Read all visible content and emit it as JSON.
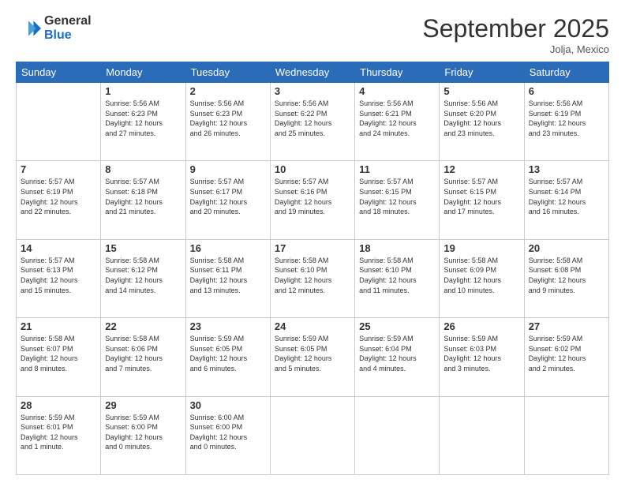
{
  "logo": {
    "general": "General",
    "blue": "Blue"
  },
  "header": {
    "month": "September 2025",
    "location": "Jolja, Mexico"
  },
  "days": [
    "Sunday",
    "Monday",
    "Tuesday",
    "Wednesday",
    "Thursday",
    "Friday",
    "Saturday"
  ],
  "weeks": [
    [
      {
        "num": "",
        "text": ""
      },
      {
        "num": "1",
        "text": "Sunrise: 5:56 AM\nSunset: 6:23 PM\nDaylight: 12 hours\nand 27 minutes."
      },
      {
        "num": "2",
        "text": "Sunrise: 5:56 AM\nSunset: 6:23 PM\nDaylight: 12 hours\nand 26 minutes."
      },
      {
        "num": "3",
        "text": "Sunrise: 5:56 AM\nSunset: 6:22 PM\nDaylight: 12 hours\nand 25 minutes."
      },
      {
        "num": "4",
        "text": "Sunrise: 5:56 AM\nSunset: 6:21 PM\nDaylight: 12 hours\nand 24 minutes."
      },
      {
        "num": "5",
        "text": "Sunrise: 5:56 AM\nSunset: 6:20 PM\nDaylight: 12 hours\nand 23 minutes."
      },
      {
        "num": "6",
        "text": "Sunrise: 5:56 AM\nSunset: 6:19 PM\nDaylight: 12 hours\nand 23 minutes."
      }
    ],
    [
      {
        "num": "7",
        "text": "Sunrise: 5:57 AM\nSunset: 6:19 PM\nDaylight: 12 hours\nand 22 minutes."
      },
      {
        "num": "8",
        "text": "Sunrise: 5:57 AM\nSunset: 6:18 PM\nDaylight: 12 hours\nand 21 minutes."
      },
      {
        "num": "9",
        "text": "Sunrise: 5:57 AM\nSunset: 6:17 PM\nDaylight: 12 hours\nand 20 minutes."
      },
      {
        "num": "10",
        "text": "Sunrise: 5:57 AM\nSunset: 6:16 PM\nDaylight: 12 hours\nand 19 minutes."
      },
      {
        "num": "11",
        "text": "Sunrise: 5:57 AM\nSunset: 6:15 PM\nDaylight: 12 hours\nand 18 minutes."
      },
      {
        "num": "12",
        "text": "Sunrise: 5:57 AM\nSunset: 6:15 PM\nDaylight: 12 hours\nand 17 minutes."
      },
      {
        "num": "13",
        "text": "Sunrise: 5:57 AM\nSunset: 6:14 PM\nDaylight: 12 hours\nand 16 minutes."
      }
    ],
    [
      {
        "num": "14",
        "text": "Sunrise: 5:57 AM\nSunset: 6:13 PM\nDaylight: 12 hours\nand 15 minutes."
      },
      {
        "num": "15",
        "text": "Sunrise: 5:58 AM\nSunset: 6:12 PM\nDaylight: 12 hours\nand 14 minutes."
      },
      {
        "num": "16",
        "text": "Sunrise: 5:58 AM\nSunset: 6:11 PM\nDaylight: 12 hours\nand 13 minutes."
      },
      {
        "num": "17",
        "text": "Sunrise: 5:58 AM\nSunset: 6:10 PM\nDaylight: 12 hours\nand 12 minutes."
      },
      {
        "num": "18",
        "text": "Sunrise: 5:58 AM\nSunset: 6:10 PM\nDaylight: 12 hours\nand 11 minutes."
      },
      {
        "num": "19",
        "text": "Sunrise: 5:58 AM\nSunset: 6:09 PM\nDaylight: 12 hours\nand 10 minutes."
      },
      {
        "num": "20",
        "text": "Sunrise: 5:58 AM\nSunset: 6:08 PM\nDaylight: 12 hours\nand 9 minutes."
      }
    ],
    [
      {
        "num": "21",
        "text": "Sunrise: 5:58 AM\nSunset: 6:07 PM\nDaylight: 12 hours\nand 8 minutes."
      },
      {
        "num": "22",
        "text": "Sunrise: 5:58 AM\nSunset: 6:06 PM\nDaylight: 12 hours\nand 7 minutes."
      },
      {
        "num": "23",
        "text": "Sunrise: 5:59 AM\nSunset: 6:05 PM\nDaylight: 12 hours\nand 6 minutes."
      },
      {
        "num": "24",
        "text": "Sunrise: 5:59 AM\nSunset: 6:05 PM\nDaylight: 12 hours\nand 5 minutes."
      },
      {
        "num": "25",
        "text": "Sunrise: 5:59 AM\nSunset: 6:04 PM\nDaylight: 12 hours\nand 4 minutes."
      },
      {
        "num": "26",
        "text": "Sunrise: 5:59 AM\nSunset: 6:03 PM\nDaylight: 12 hours\nand 3 minutes."
      },
      {
        "num": "27",
        "text": "Sunrise: 5:59 AM\nSunset: 6:02 PM\nDaylight: 12 hours\nand 2 minutes."
      }
    ],
    [
      {
        "num": "28",
        "text": "Sunrise: 5:59 AM\nSunset: 6:01 PM\nDaylight: 12 hours\nand 1 minute."
      },
      {
        "num": "29",
        "text": "Sunrise: 5:59 AM\nSunset: 6:00 PM\nDaylight: 12 hours\nand 0 minutes."
      },
      {
        "num": "30",
        "text": "Sunrise: 6:00 AM\nSunset: 6:00 PM\nDaylight: 12 hours\nand 0 minutes."
      },
      {
        "num": "",
        "text": ""
      },
      {
        "num": "",
        "text": ""
      },
      {
        "num": "",
        "text": ""
      },
      {
        "num": "",
        "text": ""
      }
    ]
  ]
}
